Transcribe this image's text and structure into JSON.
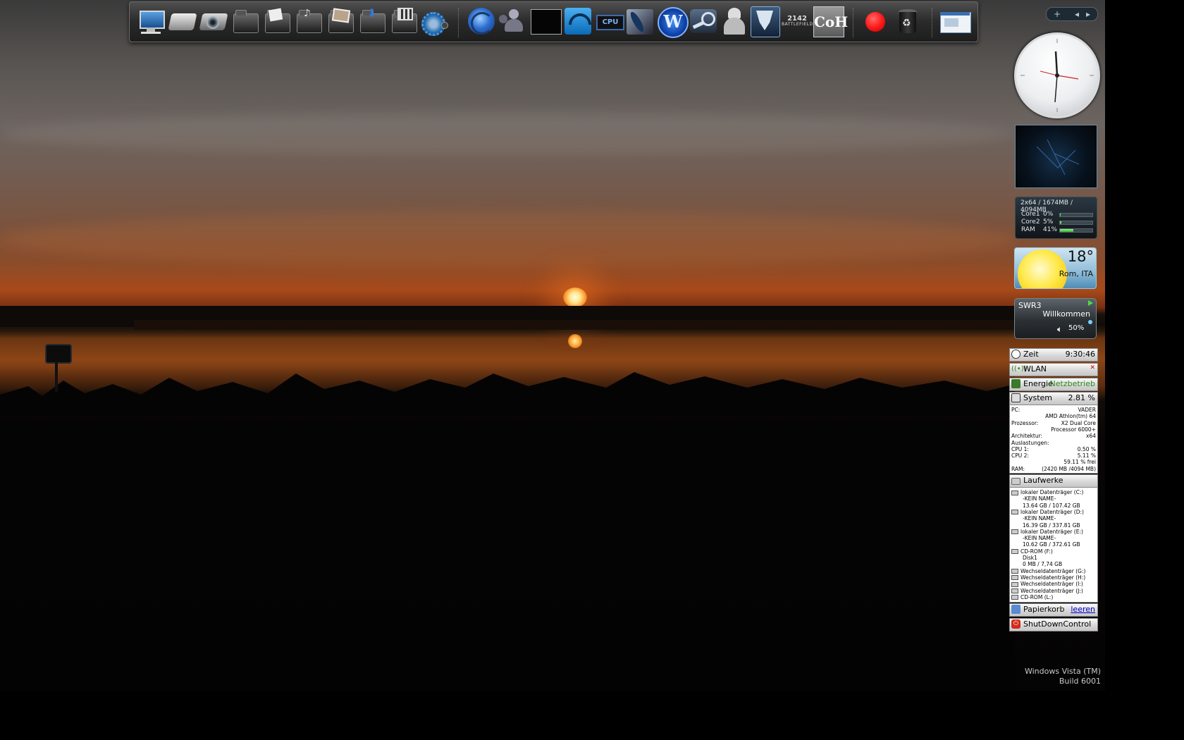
{
  "dock": {
    "icons": [
      "computer-icon",
      "hard-drive-icon",
      "dvd-drive-icon",
      "folder-icon",
      "documents-folder-icon",
      "music-folder-icon",
      "pictures-folder-icon",
      "downloads-folder-icon",
      "videos-folder-icon",
      "settings-gear-icon",
      "firefox-icon",
      "messenger-icon",
      "console-icon",
      "rss-feed-icon",
      "cpu-z-icon",
      "feather-app-icon",
      "warcraft-icon",
      "steam-icon",
      "assassins-creed-icon",
      "transformers-icon",
      "battlefield-2142-icon",
      "company-of-heroes-icon",
      "record-button-icon",
      "recycle-bin-icon",
      "window-switcher-icon"
    ],
    "battlefield_text_1": "2142",
    "battlefield_text_2": "BATTLEFIELD",
    "coh_text": "CoH",
    "cpuz_text": "CPU"
  },
  "tray": {
    "plus": "+",
    "prev": "◂",
    "next": "▸"
  },
  "cpu_meter": {
    "header": "2x64 / 1674MB / 4094MB",
    "rows": [
      {
        "label": "Core1",
        "value": "0%",
        "level": 0.0
      },
      {
        "label": "Core2",
        "value": "5%",
        "level": 0.05
      },
      {
        "label": "RAM",
        "value": "41%",
        "level": 0.41
      }
    ]
  },
  "weather": {
    "temp": "18°",
    "city": "Rom, ITA"
  },
  "radio": {
    "station": "SWR3",
    "status": "Willkommen",
    "volume": "50%"
  },
  "sidebar": {
    "time": {
      "label": "Zeit",
      "value": "9:30:46"
    },
    "wlan": {
      "label": "WLAN"
    },
    "energy": {
      "label": "Energie",
      "value": "Netzbetrieb"
    },
    "system": {
      "label": "System",
      "value": "2.81 %",
      "rows": [
        {
          "k": "PC:",
          "v": "VADER"
        },
        {
          "k": "",
          "v": "AMD Athlon(tm) 64"
        },
        {
          "k": "Prozessor:",
          "v": "X2 Dual Core"
        },
        {
          "k": "",
          "v": "Processor 6000+"
        },
        {
          "k": "Architektur:",
          "v": "x64"
        },
        {
          "k": "Auslastungen:",
          "v": ""
        },
        {
          "k": "CPU 1:",
          "v": "0.50 %"
        },
        {
          "k": "CPU 2:",
          "v": "5.11 %"
        },
        {
          "k": "",
          "v": "59.11 % frei"
        },
        {
          "k": "RAM:",
          "v": "(2420 MB /4094 MB)"
        }
      ]
    },
    "drives": {
      "label": "Laufwerke",
      "rows": [
        "lokaler Datenträger (C:)",
        "   -KEIN NAME-",
        "   13.64 GB / 107.42 GB",
        "lokaler Datenträger (D:)",
        "   -KEIN NAME-",
        "   16.39 GB / 337.81 GB",
        "lokaler Datenträger (E:)",
        "   -KEIN NAME-",
        "   10.62 GB / 372.61 GB",
        "CD-ROM (F:)",
        "   Disk1",
        "   0 MB / 7,74 GB",
        "Wechseldatenträger (G:)",
        "Wechseldatenträger (H:)",
        "Wechseldatenträger (I:)",
        "Wechseldatenträger (J:)",
        "CD-ROM (L:)"
      ]
    },
    "recycle": {
      "label": "Papierkorb",
      "link": "leeren"
    },
    "shutdown": {
      "label": "ShutDownControl"
    }
  },
  "os": {
    "line1": "Windows Vista (TM)",
    "line2": "Build 6001"
  },
  "colors": {
    "accent_green": "#2a8a1a",
    "link_blue": "#0000cc",
    "record_red": "#ff1a1a"
  }
}
